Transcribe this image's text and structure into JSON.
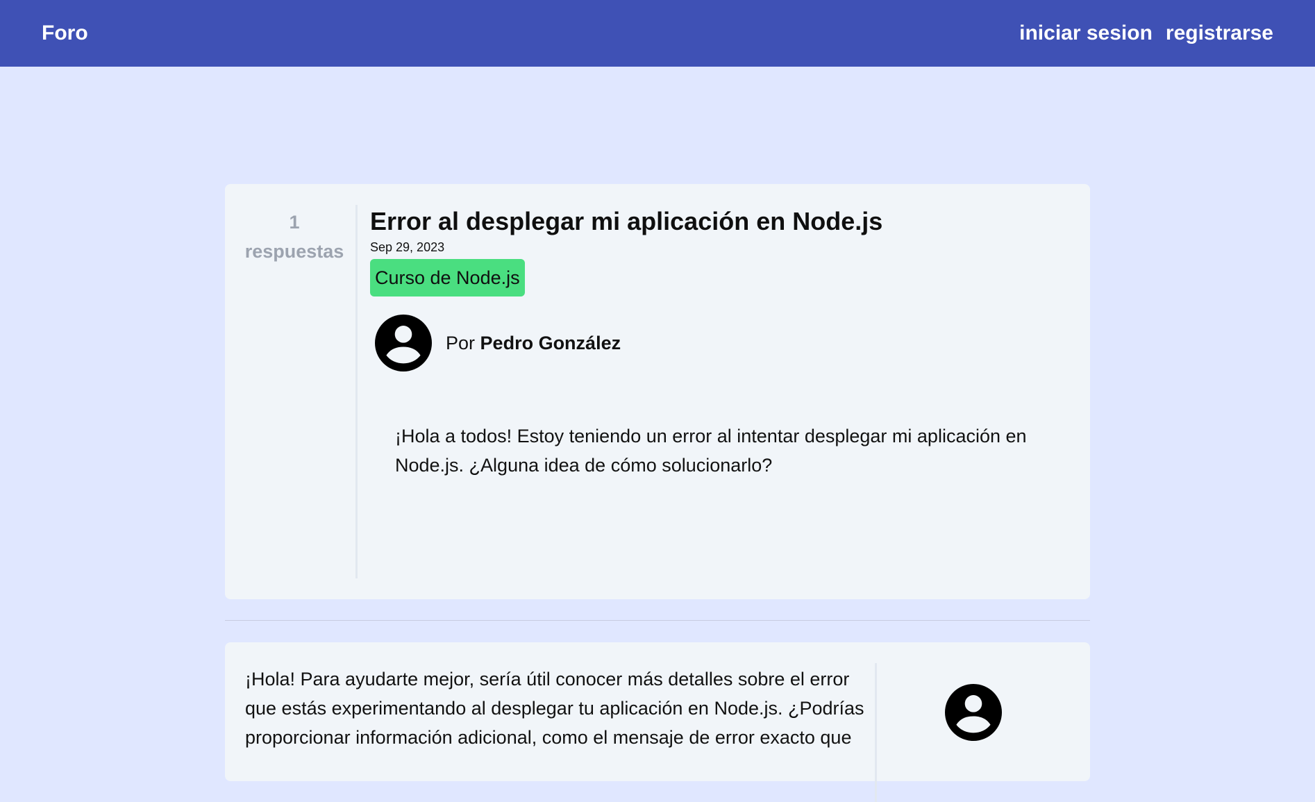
{
  "header": {
    "brand": "Foro",
    "login": "iniciar sesion",
    "register": "registrarse"
  },
  "question": {
    "reply_count": "1",
    "reply_label": "respuestas",
    "title": "Error al desplegar mi aplicación en Node.js",
    "date": "Sep 29, 2023",
    "tag": "Curso de Node.js",
    "by_prefix": "Por",
    "author": "Pedro González",
    "body": "¡Hola a todos! Estoy teniendo un error al intentar desplegar mi aplicación en Node.js. ¿Alguna idea de cómo solucionarlo?",
    "tag_color": "#4ade80"
  },
  "answer": {
    "body": "¡Hola! Para ayudarte mejor, sería útil conocer más detalles sobre el error que estás experimentando al desplegar tu aplicación en Node.js. ¿Podrías proporcionar información adicional, como el mensaje de error exacto que"
  },
  "colors": {
    "navbar": "#3f51b5",
    "page_background": "#e0e7ff",
    "card_background": "#f1f5f9"
  },
  "icons": {
    "avatar": "account-circle-icon"
  }
}
